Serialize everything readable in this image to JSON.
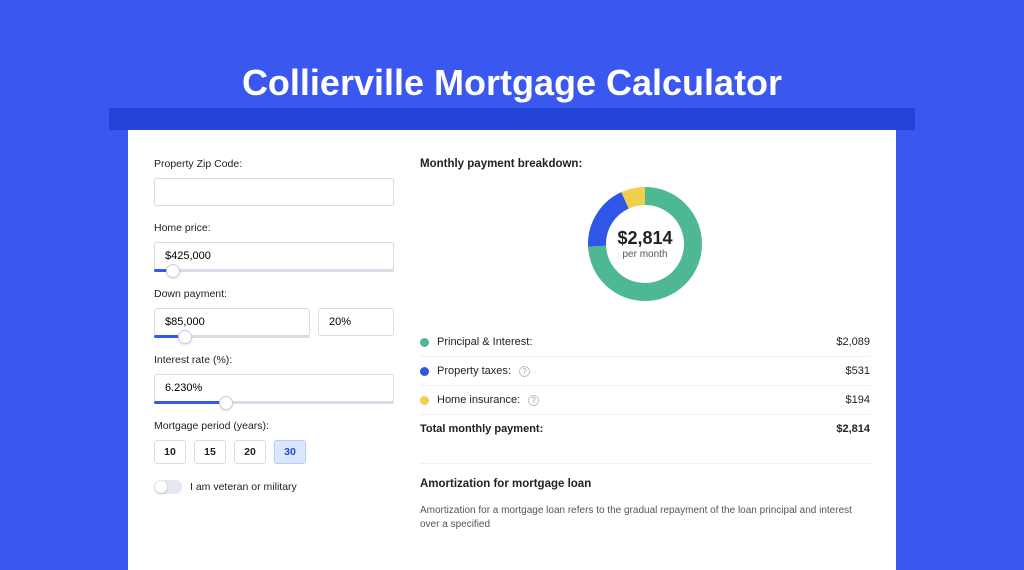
{
  "title": "Collierville Mortgage Calculator",
  "left": {
    "zip_label": "Property Zip Code:",
    "zip_value": "",
    "home_label": "Home price:",
    "home_value": "$425,000",
    "home_slider_percent": 8,
    "down_label": "Down payment:",
    "down_value": "$85,000",
    "down_percent": "20%",
    "down_slider_percent": 20,
    "rate_label": "Interest rate (%):",
    "rate_value": "6.230%",
    "rate_slider_percent": 30,
    "period_label": "Mortgage period (years):",
    "periods": [
      "10",
      "15",
      "20",
      "30"
    ],
    "period_active": "30",
    "veteran_label": "I am veteran or military"
  },
  "right": {
    "breakdown_title": "Monthly payment breakdown:",
    "donut_amount": "$2,814",
    "donut_sub": "per month",
    "items": [
      {
        "label": "Principal & Interest:",
        "value": "$2,089",
        "color": "g"
      },
      {
        "label": "Property taxes:",
        "value": "$531",
        "color": "b",
        "info": true
      },
      {
        "label": "Home insurance:",
        "value": "$194",
        "color": "y",
        "info": true
      }
    ],
    "total_label": "Total monthly payment:",
    "total_value": "$2,814",
    "amort_title": "Amortization for mortgage loan",
    "amort_text": "Amortization for a mortgage loan refers to the gradual repayment of the loan principal and interest over a specified"
  },
  "chart_data": {
    "type": "pie",
    "title": "Monthly payment breakdown",
    "series": [
      {
        "name": "Principal & Interest",
        "value": 2089,
        "color": "#4eb893"
      },
      {
        "name": "Property taxes",
        "value": 531,
        "color": "#2f56e8"
      },
      {
        "name": "Home insurance",
        "value": 194,
        "color": "#f2cf4a"
      }
    ],
    "total": 2814,
    "center_label": "$2,814 per month"
  }
}
